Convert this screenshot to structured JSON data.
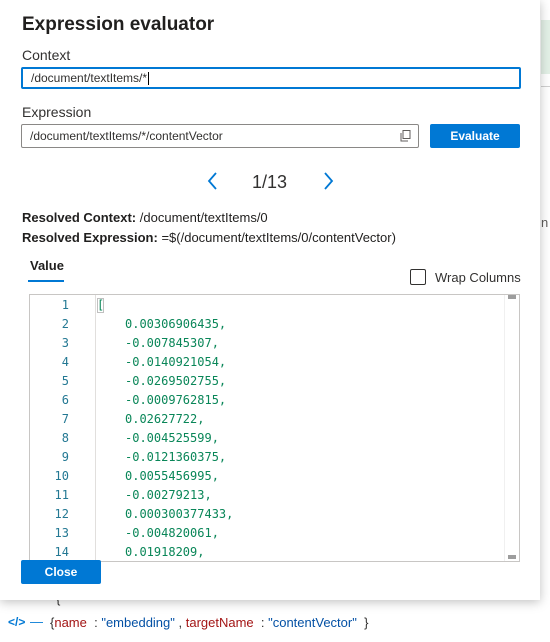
{
  "background": {
    "right_fragment": "n",
    "bottom": {
      "open_brace": "{",
      "code_icon": "</>",
      "row": {
        "open": "{",
        "key1": "name",
        "value1": "\"embedding\"",
        "key2": "targetName",
        "value2": "\"contentVector\"",
        "close": "}"
      }
    }
  },
  "dialog": {
    "title": "Expression evaluator",
    "context_label": "Context",
    "context_value": "/document/textItems/*",
    "expression_label": "Expression",
    "expression_value": "/document/textItems/*/contentVector",
    "evaluate_label": "Evaluate",
    "pager": {
      "current": "1/13"
    },
    "resolved_context_label": "Resolved Context:",
    "resolved_context_value": "/document/textItems/0",
    "resolved_expression_label": "Resolved Expression:",
    "resolved_expression_value": "=$(/document/textItems/0/contentVector)",
    "value_tab_label": "Value",
    "wrap_columns_label": "Wrap Columns",
    "wrap_columns_checked": false,
    "editor": {
      "lines": [
        {
          "n": "1",
          "text": "["
        },
        {
          "n": "2",
          "text": "0.00306906435,"
        },
        {
          "n": "3",
          "text": "-0.007845307,"
        },
        {
          "n": "4",
          "text": "-0.0140921054,"
        },
        {
          "n": "5",
          "text": "-0.0269502755,"
        },
        {
          "n": "6",
          "text": "-0.0009762815,"
        },
        {
          "n": "7",
          "text": "0.02627722,"
        },
        {
          "n": "8",
          "text": "-0.004525599,"
        },
        {
          "n": "9",
          "text": "-0.0121360375,"
        },
        {
          "n": "10",
          "text": "0.0055456995,"
        },
        {
          "n": "11",
          "text": "-0.00279213,"
        },
        {
          "n": "12",
          "text": "0.000300377433,"
        },
        {
          "n": "13",
          "text": "-0.004820061,"
        },
        {
          "n": "14",
          "text": "0.01918209,"
        }
      ]
    },
    "close_label": "Close"
  },
  "colors": {
    "accent": "#0078d4",
    "line_number": "#237893",
    "number": "#098658"
  }
}
